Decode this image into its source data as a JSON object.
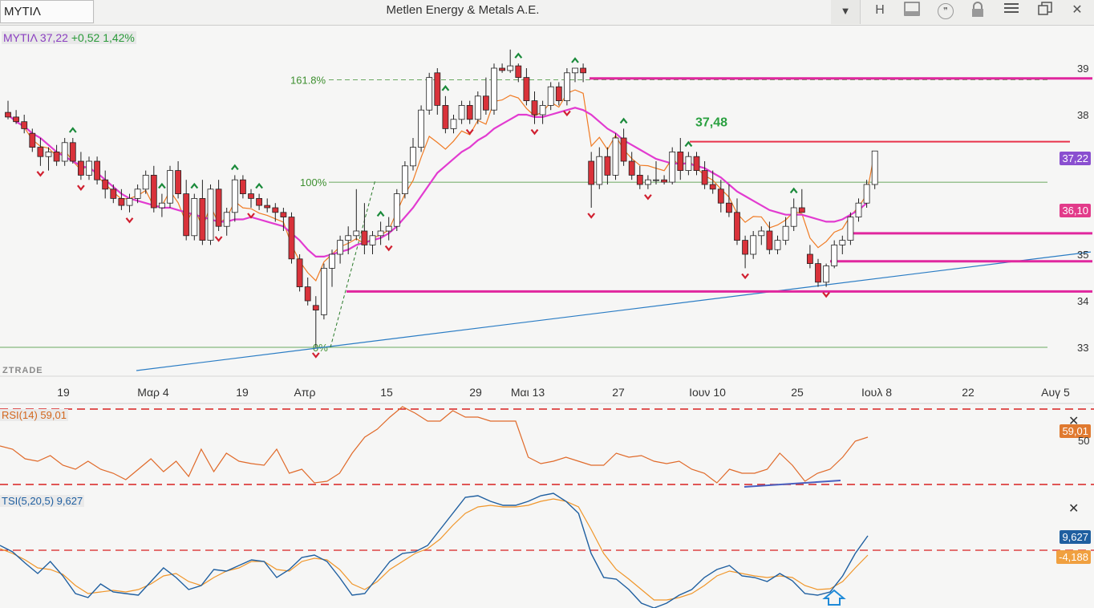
{
  "toolbar": {
    "symbol": "ΜΥΤΙΛ",
    "company": "Metlen Energy & Metals A.E.",
    "dropdown_icon": "chevron-down-icon",
    "h_button": "H",
    "icons": [
      "panel-icon",
      "quote-icon",
      "lock-icon",
      "menu-icon",
      "restore-window-icon",
      "close-icon"
    ]
  },
  "header": {
    "symbol": "ΜΥΤΙΛ",
    "price": "37,22",
    "change": "+0,52",
    "change_pct": "1,42%"
  },
  "watermark": "ZTRADE",
  "fib_labels": {
    "f1618": "161.8%",
    "f100": "100%",
    "f0": "0%"
  },
  "annotation_high": "37,48",
  "price_axis": [
    "39",
    "38",
    "37",
    "36",
    "35",
    "34",
    "33"
  ],
  "price_tags": {
    "last": "37,22",
    "ma": "36,10"
  },
  "date_axis": [
    "19",
    "Μαρ 4",
    "19",
    "Απρ",
    "15",
    "29",
    "Μαι 13",
    "27",
    "Ιουν 10",
    "25",
    "Ιουλ 8",
    "22",
    "Αυγ 5"
  ],
  "rsi": {
    "label": "RSI(14) 59,01",
    "value_tag": "59,01",
    "axis_label": "50"
  },
  "tsi": {
    "label": "TSI(5,20,5) 9,627",
    "value_tag": "9,627",
    "signal_tag": "-4,188"
  },
  "colors": {
    "up": "#ffffff",
    "down": "#d9323a",
    "ma_pink": "#e23bd0",
    "ma_orange": "#f07b24",
    "trend_blue": "#2a7cc4",
    "fib_green": "#3d8f2f",
    "rsi_line": "#e06a2a",
    "tsi_blue": "#1f5fa0",
    "tsi_orange": "#f0962a"
  },
  "chart_data": {
    "type": "candlestick",
    "x_labels": [
      "19",
      "Μαρ 4",
      "19",
      "Απρ",
      "15",
      "29",
      "Μαι 13",
      "27",
      "Ιουν 10",
      "25",
      "Ιουλ 8",
      "22",
      "Αυγ 5"
    ],
    "y_ticks": [
      33,
      34,
      35,
      36,
      37,
      38,
      39
    ],
    "candles": [
      [
        38.05,
        38.3,
        37.9,
        37.95
      ],
      [
        37.95,
        38.1,
        37.8,
        37.85
      ],
      [
        37.85,
        38.0,
        37.6,
        37.7
      ],
      [
        37.6,
        37.7,
        37.2,
        37.3
      ],
      [
        37.3,
        37.5,
        36.9,
        37.1
      ],
      [
        37.1,
        37.3,
        36.8,
        37.2
      ],
      [
        37.2,
        37.35,
        36.9,
        37.0
      ],
      [
        37.0,
        37.5,
        36.9,
        37.4
      ],
      [
        37.4,
        37.5,
        36.95,
        37.0
      ],
      [
        37.0,
        37.2,
        36.6,
        36.7
      ],
      [
        36.7,
        37.1,
        36.6,
        37.0
      ],
      [
        37.0,
        37.1,
        36.5,
        36.6
      ],
      [
        36.6,
        36.8,
        36.2,
        36.4
      ],
      [
        36.4,
        36.5,
        36.1,
        36.2
      ],
      [
        36.2,
        36.4,
        35.95,
        36.05
      ],
      [
        36.05,
        36.3,
        35.9,
        36.2
      ],
      [
        36.2,
        36.5,
        36.1,
        36.4
      ],
      [
        36.4,
        36.8,
        36.3,
        36.7
      ],
      [
        36.7,
        36.9,
        35.9,
        36.0
      ],
      [
        36.0,
        36.3,
        35.8,
        36.1
      ],
      [
        36.1,
        36.9,
        36.0,
        36.8
      ],
      [
        36.8,
        37.0,
        36.2,
        36.3
      ],
      [
        36.3,
        36.6,
        35.3,
        35.4
      ],
      [
        35.4,
        36.3,
        35.3,
        36.2
      ],
      [
        36.2,
        36.6,
        35.2,
        35.3
      ],
      [
        35.3,
        36.5,
        35.2,
        36.4
      ],
      [
        36.4,
        36.6,
        35.5,
        35.6
      ],
      [
        35.6,
        36.0,
        35.4,
        35.9
      ],
      [
        35.9,
        36.7,
        35.7,
        36.6
      ],
      [
        36.6,
        36.7,
        36.2,
        36.3
      ],
      [
        36.3,
        36.4,
        36.0,
        36.2
      ],
      [
        36.2,
        36.3,
        35.95,
        36.05
      ],
      [
        36.05,
        36.2,
        35.9,
        36.0
      ],
      [
        36.0,
        36.1,
        35.7,
        35.9
      ],
      [
        35.9,
        36.0,
        35.5,
        35.8
      ],
      [
        35.8,
        35.9,
        34.8,
        34.9
      ],
      [
        34.9,
        35.0,
        34.2,
        34.3
      ],
      [
        34.3,
        34.5,
        33.9,
        34.0
      ],
      [
        33.9,
        34.1,
        33.0,
        33.8
      ],
      [
        33.7,
        34.8,
        33.6,
        34.7
      ],
      [
        34.7,
        35.1,
        34.3,
        35.0
      ],
      [
        35.0,
        35.4,
        34.8,
        35.3
      ],
      [
        35.3,
        35.6,
        35.0,
        35.4
      ],
      [
        35.4,
        36.4,
        35.3,
        35.5
      ],
      [
        35.5,
        36.1,
        35.0,
        35.2
      ],
      [
        35.2,
        35.5,
        35.0,
        35.4
      ],
      [
        35.4,
        35.7,
        35.2,
        35.5
      ],
      [
        35.5,
        35.8,
        35.3,
        35.6
      ],
      [
        35.6,
        36.4,
        35.5,
        36.3
      ],
      [
        36.3,
        37.0,
        36.2,
        36.9
      ],
      [
        36.9,
        37.5,
        36.8,
        37.3
      ],
      [
        37.3,
        38.2,
        37.2,
        38.1
      ],
      [
        38.1,
        38.9,
        38.0,
        38.8
      ],
      [
        38.9,
        39.0,
        38.0,
        38.2
      ],
      [
        38.2,
        38.4,
        37.6,
        37.7
      ],
      [
        37.7,
        38.0,
        37.6,
        37.9
      ],
      [
        37.9,
        38.3,
        37.8,
        38.2
      ],
      [
        38.2,
        38.3,
        37.8,
        37.9
      ],
      [
        37.9,
        38.5,
        37.8,
        38.4
      ],
      [
        38.4,
        38.8,
        38.0,
        38.1
      ],
      [
        38.1,
        39.1,
        38.0,
        39.0
      ],
      [
        39.0,
        39.1,
        38.9,
        38.95
      ],
      [
        38.95,
        39.4,
        38.9,
        39.05
      ],
      [
        39.05,
        39.1,
        38.7,
        38.8
      ],
      [
        38.8,
        39.0,
        38.2,
        38.3
      ],
      [
        38.3,
        38.5,
        37.8,
        38.0
      ],
      [
        38.0,
        38.3,
        37.8,
        38.2
      ],
      [
        38.2,
        38.7,
        38.1,
        38.6
      ],
      [
        38.6,
        38.7,
        38.2,
        38.3
      ],
      [
        38.3,
        39.0,
        38.2,
        38.9
      ],
      [
        38.9,
        39.0,
        38.7,
        39.0
      ],
      [
        39.0,
        39.1,
        38.7,
        38.9
      ],
      [
        37.0,
        37.2,
        36.0,
        36.5
      ],
      [
        36.5,
        37.3,
        36.4,
        37.1
      ],
      [
        37.1,
        37.3,
        36.5,
        36.7
      ],
      [
        36.7,
        37.6,
        36.6,
        37.5
      ],
      [
        37.5,
        37.7,
        36.9,
        37.0
      ],
      [
        37.0,
        37.2,
        36.6,
        36.7
      ],
      [
        36.7,
        36.9,
        36.4,
        36.5
      ],
      [
        36.5,
        36.7,
        36.4,
        36.6
      ],
      [
        36.6,
        37.0,
        36.5,
        36.6
      ],
      [
        36.6,
        36.7,
        36.5,
        36.55
      ],
      [
        36.55,
        37.3,
        36.5,
        37.2
      ],
      [
        37.2,
        37.5,
        36.6,
        36.8
      ],
      [
        36.8,
        37.2,
        36.7,
        37.1
      ],
      [
        37.1,
        37.2,
        36.7,
        36.8
      ],
      [
        36.8,
        37.0,
        36.4,
        36.5
      ],
      [
        36.5,
        36.8,
        36.3,
        36.4
      ],
      [
        36.4,
        36.6,
        35.9,
        36.1
      ],
      [
        36.1,
        36.5,
        35.8,
        35.9
      ],
      [
        35.9,
        36.2,
        35.2,
        35.3
      ],
      [
        35.3,
        35.4,
        34.7,
        35.0
      ],
      [
        35.0,
        35.5,
        34.9,
        35.4
      ],
      [
        35.4,
        35.6,
        35.2,
        35.5
      ],
      [
        35.5,
        35.7,
        35.0,
        35.1
      ],
      [
        35.1,
        35.4,
        35.0,
        35.3
      ],
      [
        35.3,
        35.8,
        35.2,
        35.6
      ],
      [
        35.6,
        36.2,
        35.5,
        36.0
      ],
      [
        36.0,
        36.4,
        35.9,
        35.9
      ],
      [
        35.0,
        35.2,
        34.7,
        34.8
      ],
      [
        34.8,
        34.9,
        34.3,
        34.4
      ],
      [
        34.4,
        34.8,
        34.3,
        34.75
      ],
      [
        34.75,
        35.3,
        34.7,
        35.2
      ],
      [
        35.2,
        35.4,
        35.0,
        35.3
      ],
      [
        35.3,
        35.9,
        35.2,
        35.8
      ],
      [
        35.8,
        36.2,
        35.7,
        36.1
      ],
      [
        36.1,
        36.6,
        36.0,
        36.5
      ],
      [
        36.5,
        37.2,
        36.4,
        37.22
      ]
    ],
    "ma_pink": [
      38.0,
      37.85,
      37.75,
      37.6,
      37.5,
      37.35,
      37.2,
      37.1,
      37.0,
      36.9,
      36.85,
      36.75,
      36.6,
      36.45,
      36.3,
      36.2,
      36.15,
      36.1,
      36.05,
      36.0,
      36.0,
      35.95,
      35.9,
      35.85,
      35.8,
      35.75,
      35.7,
      35.7,
      35.75,
      35.75,
      35.8,
      35.75,
      35.7,
      35.65,
      35.6,
      35.45,
      35.3,
      35.1,
      34.95,
      34.95,
      35.0,
      35.05,
      35.1,
      35.2,
      35.25,
      35.3,
      35.35,
      35.45,
      35.6,
      35.8,
      36.0,
      36.25,
      36.5,
      36.75,
      36.9,
      37.05,
      37.2,
      37.3,
      37.45,
      37.55,
      37.7,
      37.8,
      37.9,
      38.0,
      38.0,
      37.95,
      37.95,
      38.0,
      38.05,
      38.1,
      38.15,
      38.1,
      38.0,
      37.85,
      37.7,
      37.6,
      37.45,
      37.35,
      37.25,
      37.15,
      37.05,
      37.0,
      36.95,
      36.95,
      36.95,
      36.9,
      36.85,
      36.75,
      36.65,
      36.5,
      36.35,
      36.25,
      36.15,
      36.05,
      35.95,
      35.9,
      35.85,
      35.85,
      35.85,
      35.8,
      35.75,
      35.7,
      35.7,
      35.75,
      35.85,
      35.95,
      36.1
    ],
    "rsi_axis": [
      0,
      100
    ],
    "tsi_axis": [
      -30,
      30
    ]
  }
}
